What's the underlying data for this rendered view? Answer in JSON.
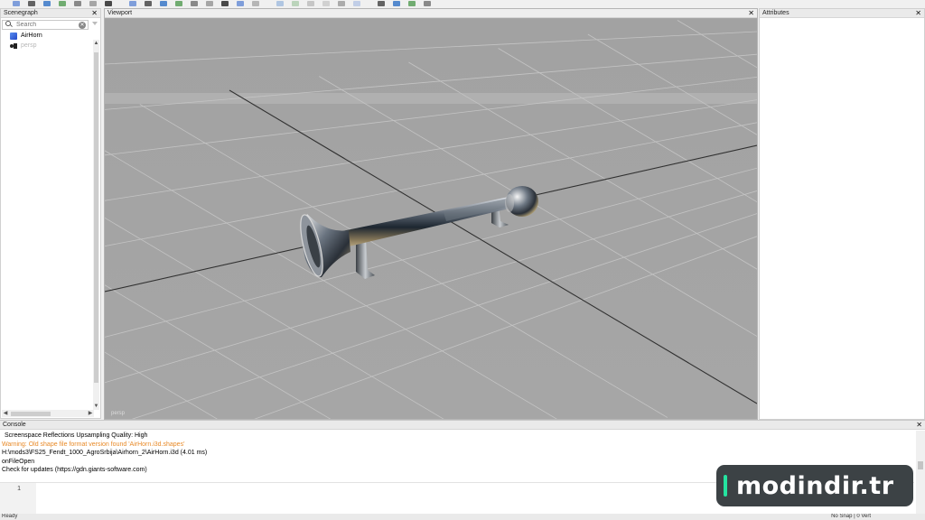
{
  "toolbar": {
    "buttons": [
      "new-file-icon",
      "open-file-icon",
      "save-icon",
      "reload-icon",
      "export-icon",
      "undo-icon",
      "redo-icon",
      "play-icon",
      "eye-icon",
      "zoom-icon",
      "select-icon",
      "axis-icon",
      "move-icon",
      "rotate-icon",
      "scale-icon",
      "align-icon",
      "snap-icon",
      "mirror-icon",
      "group-icon",
      "link-icon",
      "paint-icon",
      "cube-icon",
      "light-icon",
      "gear-icon",
      "grid-icon",
      "window-icon"
    ]
  },
  "scenegraph": {
    "title": "Scenegraph",
    "search_placeholder": "Search",
    "items": [
      {
        "label": "AirHorn",
        "icon": "cube-icon",
        "muted": false
      },
      {
        "label": "persp",
        "icon": "camera-icon",
        "muted": true
      }
    ]
  },
  "viewport": {
    "title": "Viewport",
    "camera_label": "persp",
    "colors": {
      "background": "#a5a5a5",
      "grid": "#c4c4c4",
      "axis": "#303030"
    }
  },
  "attributes": {
    "title": "Attributes"
  },
  "console": {
    "title": "Console",
    "lines": [
      {
        "text": "Screenspace Reflections Upsampling Quality: High",
        "level": "info"
      },
      {
        "text": "Warning: Old shape file format version found 'AirHorn.i3d.shapes'",
        "level": "warning"
      },
      {
        "text": "H:\\mods3\\FS25_Fendt_1000_AgroSrbija\\Airhorn_2\\AirHorn.i3d (4.01 ms)",
        "level": "info"
      },
      {
        "text": "onFileOpen",
        "level": "info"
      },
      {
        "text": "Check for updates (https://gdn.giants-software.com)",
        "level": "info"
      }
    ],
    "line_number": "1",
    "warning_color": "#e88a28"
  },
  "statusbar": {
    "left": "Ready",
    "right": "No Snap | 0 Vert"
  },
  "watermark": {
    "text": "modindir.tr",
    "accent": "#25e3a0"
  }
}
